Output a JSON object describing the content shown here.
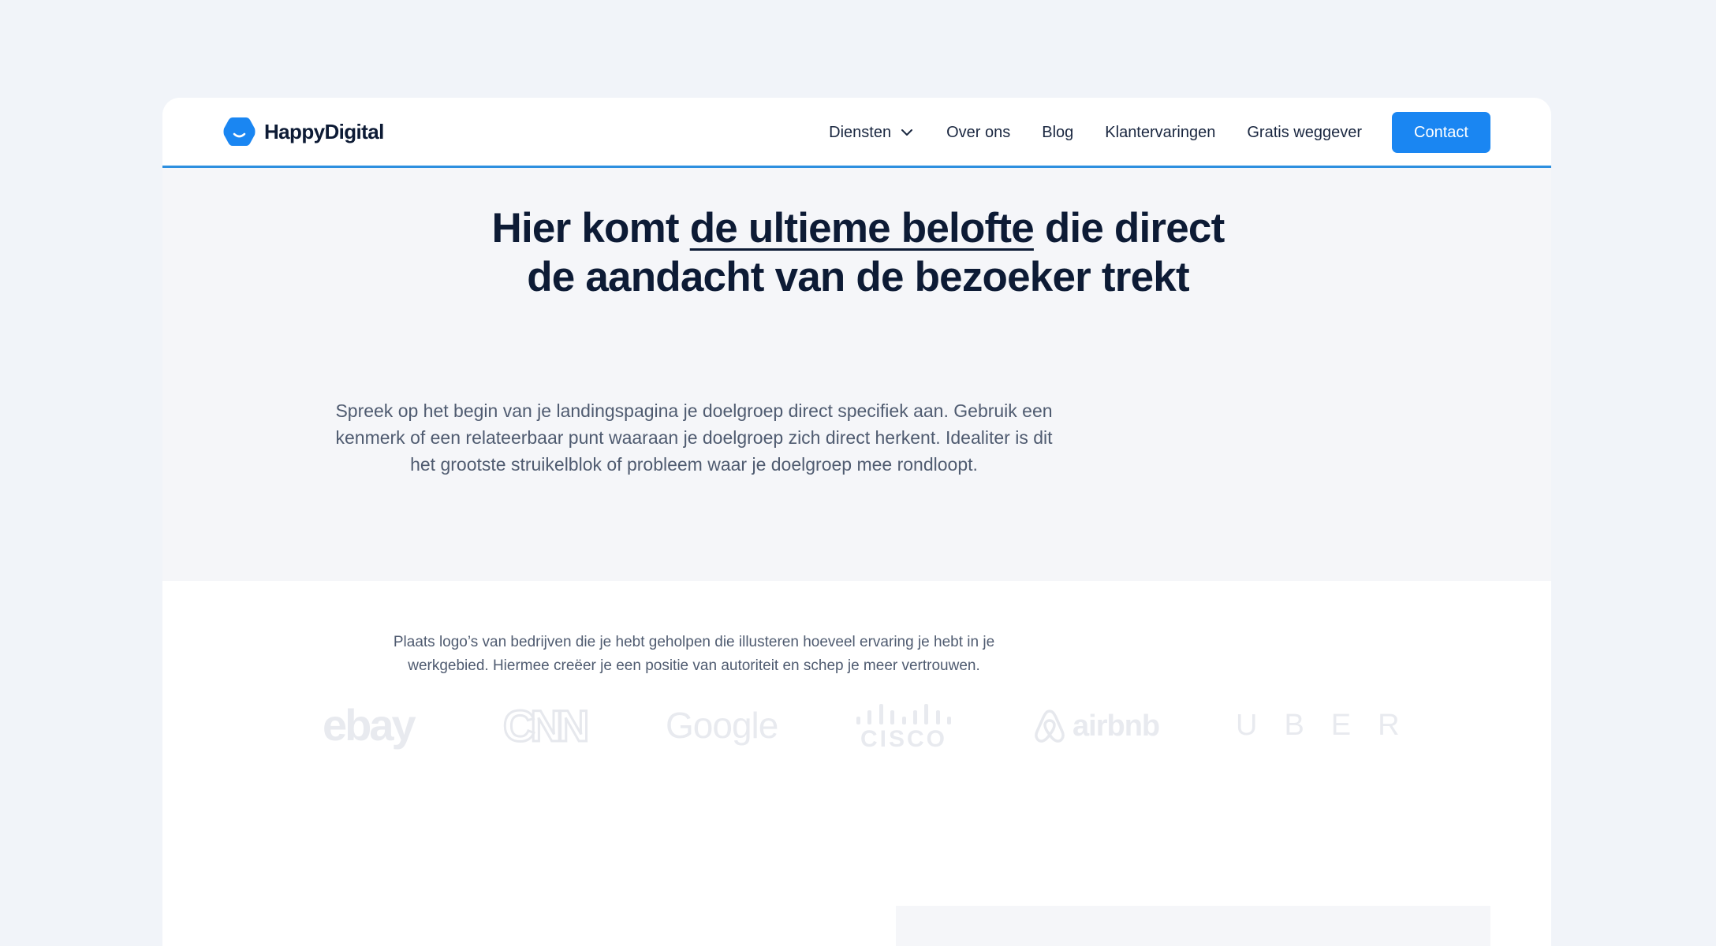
{
  "brand": {
    "name": "HappyDigital",
    "accent": "#1a86f2"
  },
  "nav": {
    "items": [
      {
        "label": "Diensten",
        "has_dropdown": true
      },
      {
        "label": "Over ons"
      },
      {
        "label": "Blog"
      },
      {
        "label": "Klantervaringen"
      },
      {
        "label": "Gratis weggever"
      }
    ],
    "cta": "Contact"
  },
  "hero": {
    "title_before": "Hier komt ",
    "title_underlined": "de ultieme belofte",
    "title_after_line1": " die direct",
    "title_line2": "de aandacht van de bezoeker trekt",
    "subtitle": "Spreek op het begin van je landingspagina je doelgroep direct specifiek aan. Gebruik een kenmerk of een relateerbaar punt waaraan je doelgroep zich direct herkent. Idealiter is dit het grootste struikelblok of probleem waar je doelgroep mee rondloopt."
  },
  "logos": {
    "intro": "Plaats logo’s van bedrijven die je hebt geholpen die illusteren hoeveel ervaring je hebt in je werkgebied. Hiermee creëer je een positie van autoriteit en schep je meer vertrouwen.",
    "brands": [
      "ebay",
      "CNN",
      "Google",
      "CISCO",
      "airbnb",
      "UBER"
    ]
  }
}
